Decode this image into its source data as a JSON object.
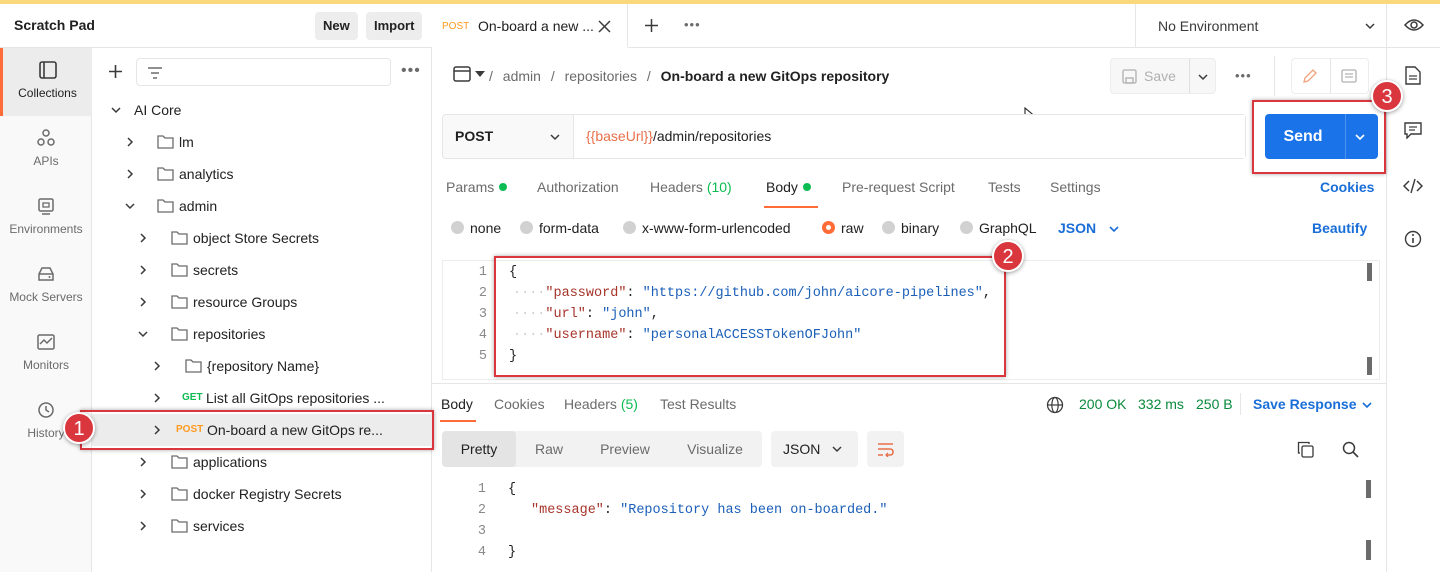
{
  "header": {
    "title": "Scratch Pad",
    "new_label": "New",
    "import_label": "Import"
  },
  "rail": [
    {
      "label": "Collections",
      "icon": "collections-icon",
      "active": true
    },
    {
      "label": "APIs",
      "icon": "apis-icon"
    },
    {
      "label": "Environments",
      "icon": "environments-icon"
    },
    {
      "label": "Mock Servers",
      "icon": "mock-servers-icon"
    },
    {
      "label": "Monitors",
      "icon": "monitors-icon"
    },
    {
      "label": "History",
      "icon": "history-icon"
    }
  ],
  "tree": {
    "root": "AI Core",
    "items": [
      {
        "label": "lm"
      },
      {
        "label": "analytics"
      },
      {
        "label": "admin"
      },
      {
        "label": "object Store Secrets"
      },
      {
        "label": "secrets"
      },
      {
        "label": "resource Groups"
      },
      {
        "label": "repositories"
      },
      {
        "label": "{repository Name}"
      },
      {
        "method": "GET",
        "label": "List all GitOps repositories ..."
      },
      {
        "method": "POST",
        "label": "On-board a new GitOps re..."
      },
      {
        "label": "applications"
      },
      {
        "label": "docker Registry Secrets"
      },
      {
        "label": "services"
      }
    ]
  },
  "tab": {
    "method": "POST",
    "title": "On-board a new ..."
  },
  "environment": {
    "selected": "No Environment"
  },
  "breadcrumb": {
    "part1": "admin",
    "part2": "repositories",
    "current": "On-board a new GitOps repository"
  },
  "toolbar": {
    "save_label": "Save"
  },
  "request": {
    "method": "POST",
    "url_var": "{{baseUrl}}",
    "url_path": "/admin/repositories",
    "send_label": "Send"
  },
  "req_tabs": {
    "params": "Params",
    "authorization": "Authorization",
    "headers": "Headers",
    "headers_count": "(10)",
    "body": "Body",
    "prerequest": "Pre-request Script",
    "tests": "Tests",
    "settings": "Settings",
    "cookies": "Cookies"
  },
  "body_types": {
    "none": "none",
    "form_data": "form-data",
    "urlencoded": "x-www-form-urlencoded",
    "raw": "raw",
    "binary": "binary",
    "graphql": "GraphQL",
    "json": "JSON",
    "beautify": "Beautify"
  },
  "req_body": {
    "lines": [
      "1",
      "2",
      "3",
      "4",
      "5"
    ],
    "open": "{",
    "close": "}",
    "password_key": "\"password\"",
    "password_val": "\"https://github.com/john/aicore-pipelines\"",
    "url_key": "\"url\"",
    "url_val": "\"john\"",
    "username_key": "\"username\"",
    "username_val": "\"personalACCESSTokenOFJohn\""
  },
  "resp_tabs": {
    "body": "Body",
    "cookies": "Cookies",
    "headers": "Headers",
    "headers_count": "(5)",
    "test_results": "Test Results",
    "status": "200 OK",
    "time": "332 ms",
    "size": "250 B",
    "save_response": "Save Response"
  },
  "resp_view": {
    "pretty": "Pretty",
    "raw": "Raw",
    "preview": "Preview",
    "visualize": "Visualize",
    "format": "JSON"
  },
  "resp_body": {
    "lines": [
      "1",
      "2",
      "3",
      "4"
    ],
    "open": "{",
    "close": "}",
    "message_key": "\"message\"",
    "message_val": "\"Repository has been on-boarded.\""
  },
  "annotations": [
    "1",
    "2",
    "3"
  ],
  "colors": {
    "accent": "#ff6c37",
    "send": "#1a73e8",
    "annotation": "#d9363e",
    "success": "#0cbb52"
  }
}
